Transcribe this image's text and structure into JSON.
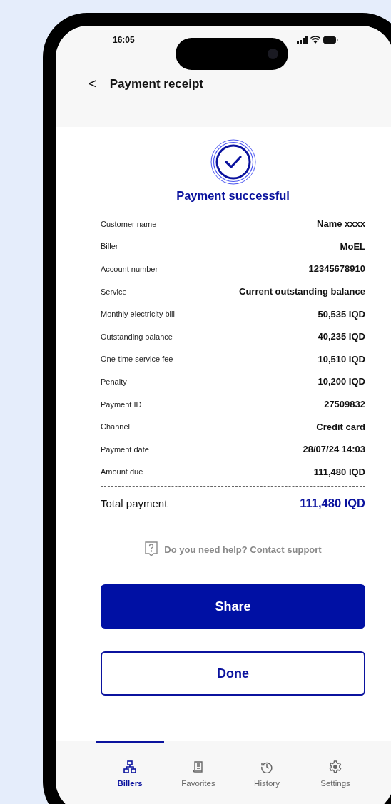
{
  "status_bar": {
    "time": "16:05"
  },
  "header": {
    "back": "<",
    "title": "Payment receipt"
  },
  "status": {
    "title": "Payment successful"
  },
  "details": [
    {
      "label": "Customer name",
      "value": "Name xxxx"
    },
    {
      "label": "Biller",
      "value": "MoEL"
    },
    {
      "label": "Account number",
      "value": "12345678910"
    },
    {
      "label": "Service",
      "value": "Current outstanding balance"
    },
    {
      "label": "Monthly electricity bill",
      "value": "50,535 IQD"
    },
    {
      "label": "Outstanding balance",
      "value": "40,235 IQD"
    },
    {
      "label": "One-time service fee",
      "value": "10,510 IQD"
    },
    {
      "label": "Penalty",
      "value": "10,200 IQD"
    },
    {
      "label": "Payment ID",
      "value": "27509832"
    },
    {
      "label": "Channel",
      "value": "Credit card"
    },
    {
      "label": "Payment date",
      "value": "28/07/24 14:03"
    },
    {
      "label": "Amount due",
      "value": "111,480 IQD"
    }
  ],
  "total": {
    "label": "Total payment",
    "value": "111,480 IQD"
  },
  "help": {
    "text": "Do you need help?",
    "link": "Contact support"
  },
  "buttons": [
    {
      "label": "Share",
      "kind": "primary"
    },
    {
      "label": "Done",
      "kind": "secondary"
    }
  ],
  "nav": [
    {
      "label": "Billers",
      "kind": "hierarchy",
      "selected": true
    },
    {
      "label": "Favorites",
      "kind": "document",
      "selected": false
    },
    {
      "label": "History",
      "kind": "history",
      "selected": false
    },
    {
      "label": "Settings",
      "kind": "settings",
      "selected": false
    }
  ]
}
